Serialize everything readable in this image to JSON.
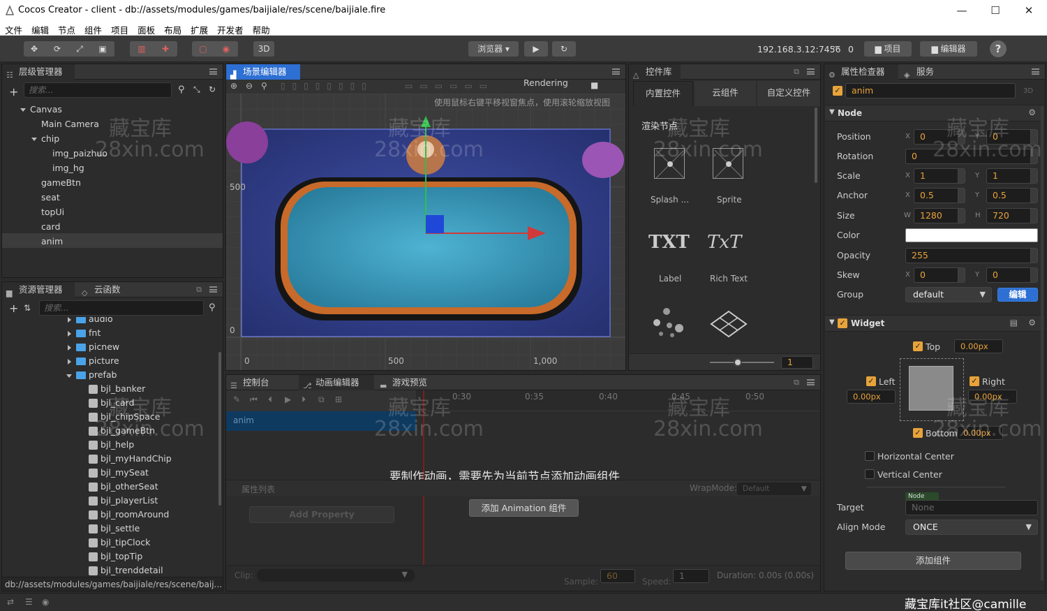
{
  "window": {
    "title": "Cocos Creator - client - db://assets/modules/games/baijiale/res/scene/baijiale.fire",
    "minimize": "—",
    "maximize": "☐",
    "close": "✕"
  },
  "menu": [
    "文件",
    "编辑",
    "节点",
    "组件",
    "项目",
    "面板",
    "布局",
    "扩展",
    "开发者",
    "帮助"
  ],
  "toolbar": {
    "mode_3d": "3D",
    "browser": "浏览器",
    "browser_caret": "▾",
    "play": "▶",
    "refresh": "↻",
    "ip": "192.168.3.12:7456",
    "count": "0",
    "project_btn": "项目",
    "editor_btn": "编辑器",
    "help": "?"
  },
  "hierarchy": {
    "tab": "层级管理器",
    "search_placeholder": "搜索...",
    "items": [
      {
        "label": "Canvas",
        "depth": 0,
        "expanded": true
      },
      {
        "label": "Main Camera",
        "depth": 1
      },
      {
        "label": "chip",
        "depth": 1,
        "expanded": true
      },
      {
        "label": "img_paizhuo",
        "depth": 2
      },
      {
        "label": "img_hg",
        "depth": 2
      },
      {
        "label": "gameBtn",
        "depth": 1
      },
      {
        "label": "seat",
        "depth": 1
      },
      {
        "label": "topUi",
        "depth": 1
      },
      {
        "label": "card",
        "depth": 1
      },
      {
        "label": "anim",
        "depth": 1,
        "selected": true
      }
    ]
  },
  "assets": {
    "tab": "资源管理器",
    "tab2": "云函数",
    "search_placeholder": "搜索...",
    "folders": [
      "audio",
      "fnt",
      "picnew",
      "picture",
      "prefab"
    ],
    "prefabs": [
      "bjl_banker",
      "bjl_card",
      "bjl_chipSpace",
      "bjl_gameBtn",
      "bjl_help",
      "bjl_myHandChip",
      "bjl_mySeat",
      "bjl_otherSeat",
      "bjl_playerList",
      "bjl_roomAround",
      "bjl_settle",
      "bjl_tipClock",
      "bjl_topTip",
      "bjl_trenddetail"
    ],
    "path": "db://assets/modules/games/baijiale/res/scene/baij..."
  },
  "scene": {
    "tab": "场景编辑器",
    "rendering": "Rendering",
    "hint": "使用鼠标右键平移视窗焦点，使用滚轮缩放视图",
    "ruler_y": [
      "500",
      "0"
    ],
    "ruler_x": [
      "0",
      "500",
      "1,000"
    ]
  },
  "controls": {
    "tab": "控件库",
    "tabs": [
      "内置控件",
      "云组件",
      "自定义控件"
    ],
    "section": "渲染节点",
    "items": [
      {
        "label": "Splash ...",
        "icon": "splash-icon"
      },
      {
        "label": "Sprite",
        "icon": "sprite-icon"
      },
      {
        "label": "Label",
        "icon": "label-icon",
        "glyph": "TXT"
      },
      {
        "label": "Rich Text",
        "icon": "richtext-icon",
        "glyph": "TxT"
      }
    ],
    "zoom_value": "1"
  },
  "bottom": {
    "tabs": [
      "控制台",
      "动画编辑器",
      "游戏预览"
    ],
    "timeline": [
      "0:30",
      "0:35",
      "0:40",
      "0:45",
      "0:50"
    ],
    "node": "anim",
    "message": "要制作动画，需要先为当前节点添加动画组件",
    "prop_list": "属性列表",
    "wrapmode_label": "WrapMode:",
    "wrapmode_value": "Default",
    "add_property": "Add Property",
    "add_animation": "添加 Animation 组件",
    "clip_label": "Clip:",
    "sample_label": "Sample:",
    "sample_value": "60",
    "speed_label": "Speed:",
    "speed_value": "1",
    "duration": "Duration: 0.00s (0.00s)"
  },
  "inspector": {
    "tab": "属性检查器",
    "tab2": "服务",
    "node_name": "anim",
    "badge_3d": "3D",
    "node_section": "Node",
    "props": {
      "position": {
        "label": "Position",
        "x": "0",
        "y": "0"
      },
      "rotation": {
        "label": "Rotation",
        "value": "0"
      },
      "scale": {
        "label": "Scale",
        "x": "1",
        "y": "1"
      },
      "anchor": {
        "label": "Anchor",
        "x": "0.5",
        "y": "0.5"
      },
      "size": {
        "label": "Size",
        "w": "1280",
        "h": "720"
      },
      "color": {
        "label": "Color",
        "value": "#ffffff"
      },
      "opacity": {
        "label": "Opacity",
        "value": "255"
      },
      "skew": {
        "label": "Skew",
        "x": "0",
        "y": "0"
      },
      "group": {
        "label": "Group",
        "value": "default",
        "edit": "编辑"
      }
    },
    "axis": {
      "x": "X",
      "y": "Y",
      "w": "W",
      "h": "H"
    },
    "widget": {
      "title": "Widget",
      "top": "Top",
      "top_value": "0.00px",
      "left": "Left",
      "left_value": "0.00px",
      "right": "Right",
      "right_value": "0.00px",
      "bottom": "Bottom",
      "bottom_value": "0.00px",
      "hcenter": "Horizontal Center",
      "vcenter": "Vertical Center",
      "target_label": "Target",
      "target_tag": "Node",
      "target_value": "None",
      "align_label": "Align Mode",
      "align_value": "ONCE"
    },
    "add_component": "添加组件"
  },
  "watermark": {
    "line1": "藏宝库",
    "line2": "28xin.com"
  },
  "corner_credit": "藏宝库it社区@camille",
  "colors": {
    "accent": "#e8a33a",
    "selected": "#2d6fd2",
    "folder": "#4aa3e8"
  }
}
